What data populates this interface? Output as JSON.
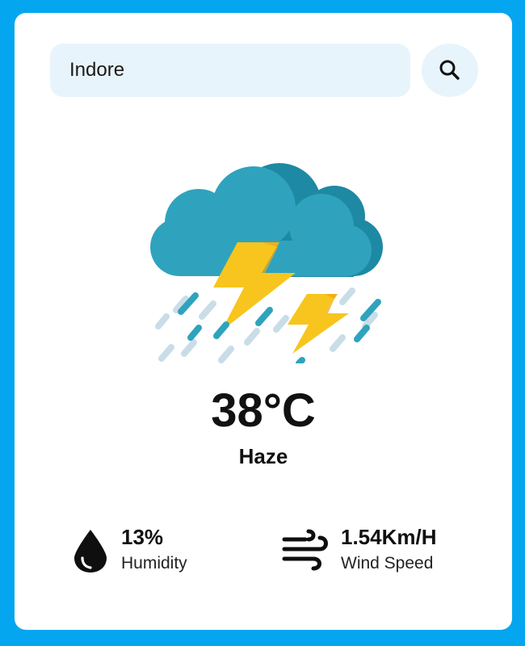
{
  "search": {
    "value": "Indore",
    "button_icon": "search-icon"
  },
  "weather": {
    "icon": "thunderstorm-icon",
    "temperature": "38°C",
    "condition": "Haze"
  },
  "stats": {
    "humidity": {
      "icon": "water-drop-icon",
      "value": "13%",
      "label": "Humidity"
    },
    "wind": {
      "icon": "wind-icon",
      "value": "1.54Km/H",
      "label": "Wind Speed"
    }
  },
  "colors": {
    "page_background": "#05a6f0",
    "card_background": "#ffffff",
    "search_background": "#e8f4fb",
    "cloud_main": "#2e9fb8",
    "bolt": "#f6c21c"
  }
}
